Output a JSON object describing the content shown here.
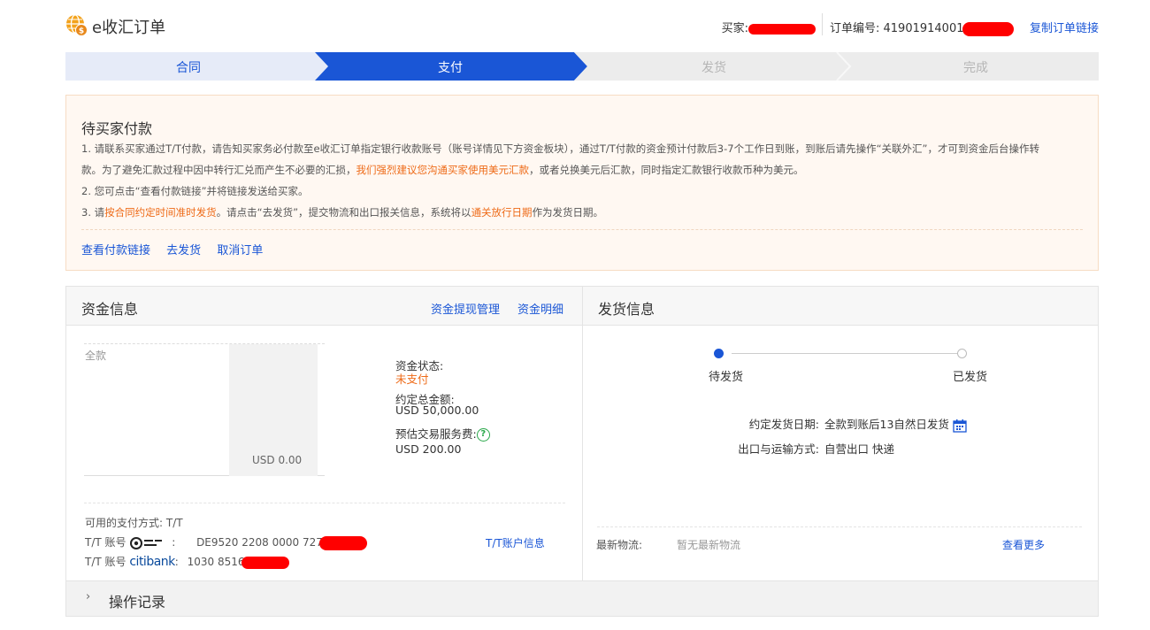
{
  "header": {
    "title": "e收汇订单",
    "buyer_label": "买家:",
    "order_label": "订单编号: 41901914001",
    "copy_link": "复制订单链接"
  },
  "steps": [
    "合同",
    "支付",
    "发货",
    "完成"
  ],
  "notice": {
    "title": "待买家付款",
    "line1": "1. 请联系买家通过T/T付款，请告知买家务必付款至e收汇订单指定银行收款账号（账号详情见下方资金板块），通过T/T付款的资金预计付款后3-7个工作日到账，到账后请先操作“关联外汇”，才可到资金后台操作转",
    "line2a": "款。为了避免汇款过程中因中转行汇兑而产生不必要的汇损，",
    "line2b": "我们强烈建议您沟通买家使用美元汇款",
    "line2c": "，或者兑换美元后汇款，同时指定汇款银行收款币种为美元。",
    "line3": "2. 您可点击“查看付款链接”并将链接发送给买家。",
    "line4a": "3. 请",
    "line4b": "按合同约定时间准时发货",
    "line4c": "。请点击“去发货”，提交物流和出口报关信息，系统将以",
    "line4d": "通关放行日期",
    "line4e": "作为发货日期。",
    "actions": [
      "查看付款链接",
      "去发货",
      "取消订单"
    ]
  },
  "funds": {
    "title": "资金信息",
    "link_withdraw": "资金提现管理",
    "link_detail": "资金明细",
    "chart_category": "全款",
    "chart_value": "USD 0.00",
    "status_label": "资金状态:",
    "status_value": "未支付",
    "total_label": "约定总金额:",
    "total_value": "USD 50,000.00",
    "fee_label": "预估交易服务费:",
    "fee_value": "USD 200.00",
    "payment_methods": "可用的支付方式: T/T",
    "tt_account_label": "T/T 账号",
    "tt_account1_sep": ":",
    "tt_account1": "DE9520 2208 0000 727",
    "tt_account2_sep": ":",
    "tt_account2": "1030 8516",
    "citibank": "citibank",
    "tt_info_link": "T/T账户信息"
  },
  "shipping": {
    "title": "发货信息",
    "state_pending": "待发货",
    "state_shipped": "已发货",
    "date_label": "约定发货日期:",
    "date_value": "全款到账后13自然日发货",
    "method_label": "出口与运输方式:",
    "method_value": "自营出口 快递",
    "logistics_label": "最新物流:",
    "logistics_value": "暂无最新物流",
    "more_link": "查看更多"
  },
  "records": {
    "chevron": "›",
    "title": "操作记录"
  },
  "colors": {
    "accent": "#1a56d6",
    "orange": "#ee6a17",
    "redaction": "#ff0000"
  }
}
